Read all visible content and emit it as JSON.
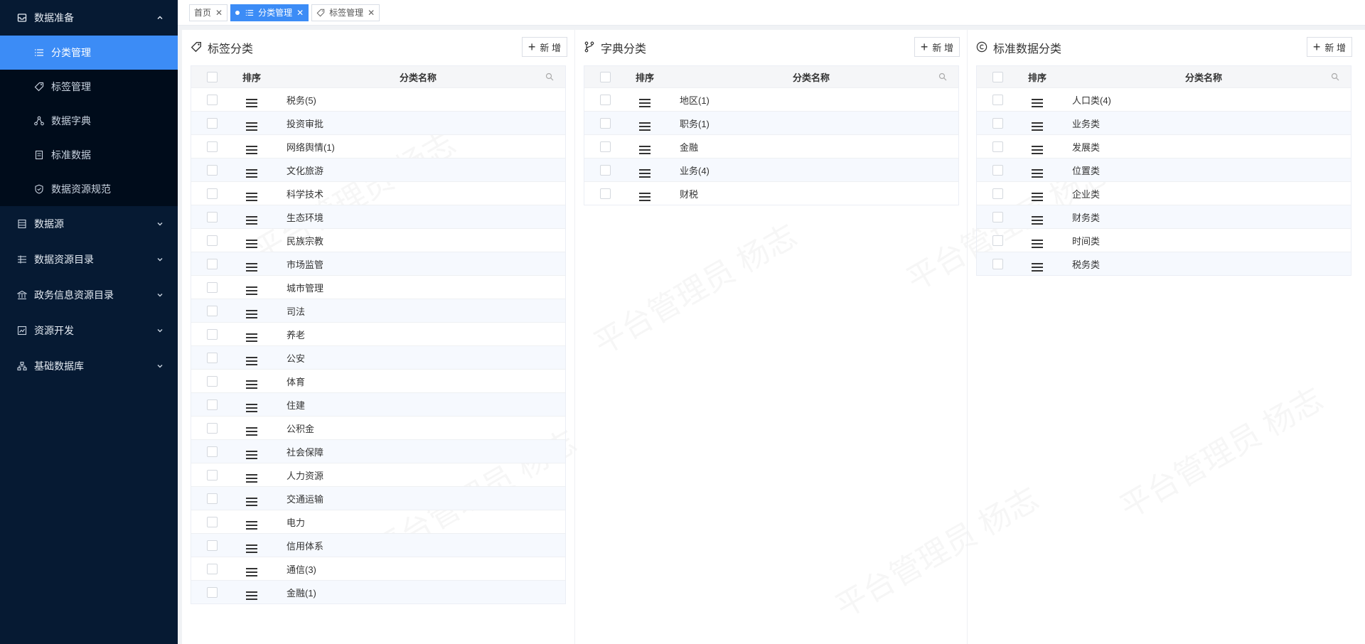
{
  "sidebar": {
    "group_data_prep": "数据准备",
    "sub_items": [
      {
        "label": "分类管理",
        "icon": "list-icon"
      },
      {
        "label": "标签管理",
        "icon": "tag-icon"
      },
      {
        "label": "数据字典",
        "icon": "tree-icon"
      },
      {
        "label": "标准数据",
        "icon": "doc-icon"
      },
      {
        "label": "数据资源规范",
        "icon": "shield-icon"
      }
    ],
    "groups": [
      {
        "label": "数据源",
        "icon": "database-icon"
      },
      {
        "label": "数据资源目录",
        "icon": "catalog-icon"
      },
      {
        "label": "政务信息资源目录",
        "icon": "bank-icon"
      },
      {
        "label": "资源开发",
        "icon": "chart-icon"
      },
      {
        "label": "基础数据库",
        "icon": "org-icon"
      }
    ]
  },
  "tabs": [
    {
      "label": "首页"
    },
    {
      "label": "分类管理"
    },
    {
      "label": "标签管理"
    }
  ],
  "panels": {
    "tag": {
      "title": "标签分类",
      "add_label": "新 增",
      "col_sort": "排序",
      "col_name": "分类名称",
      "rows": [
        "税务(5)",
        "投资审批",
        "网络舆情(1)",
        "文化旅游",
        "科学技术",
        "生态环境",
        "民族宗教",
        "市场监管",
        "城市管理",
        "司法",
        "养老",
        "公安",
        "体育",
        "住建",
        "公积金",
        "社会保障",
        "人力资源",
        "交通运输",
        "电力",
        "信用体系",
        "通信(3)",
        "金融(1)"
      ]
    },
    "dict": {
      "title": "字典分类",
      "add_label": "新 增",
      "col_sort": "排序",
      "col_name": "分类名称",
      "rows": [
        "地区(1)",
        "职务(1)",
        "金融",
        "业务(4)",
        "财税"
      ]
    },
    "std": {
      "title": "标准数据分类",
      "add_label": "新 增",
      "col_sort": "排序",
      "col_name": "分类名称",
      "rows": [
        "人口类(4)",
        "业务类",
        "发展类",
        "位置类",
        "企业类",
        "财务类",
        "时间类",
        "税务类"
      ]
    }
  },
  "colors": {
    "accent": "#3c8cf6",
    "sidebar_bg": "#061a33",
    "submenu_bg": "#000c1b"
  }
}
